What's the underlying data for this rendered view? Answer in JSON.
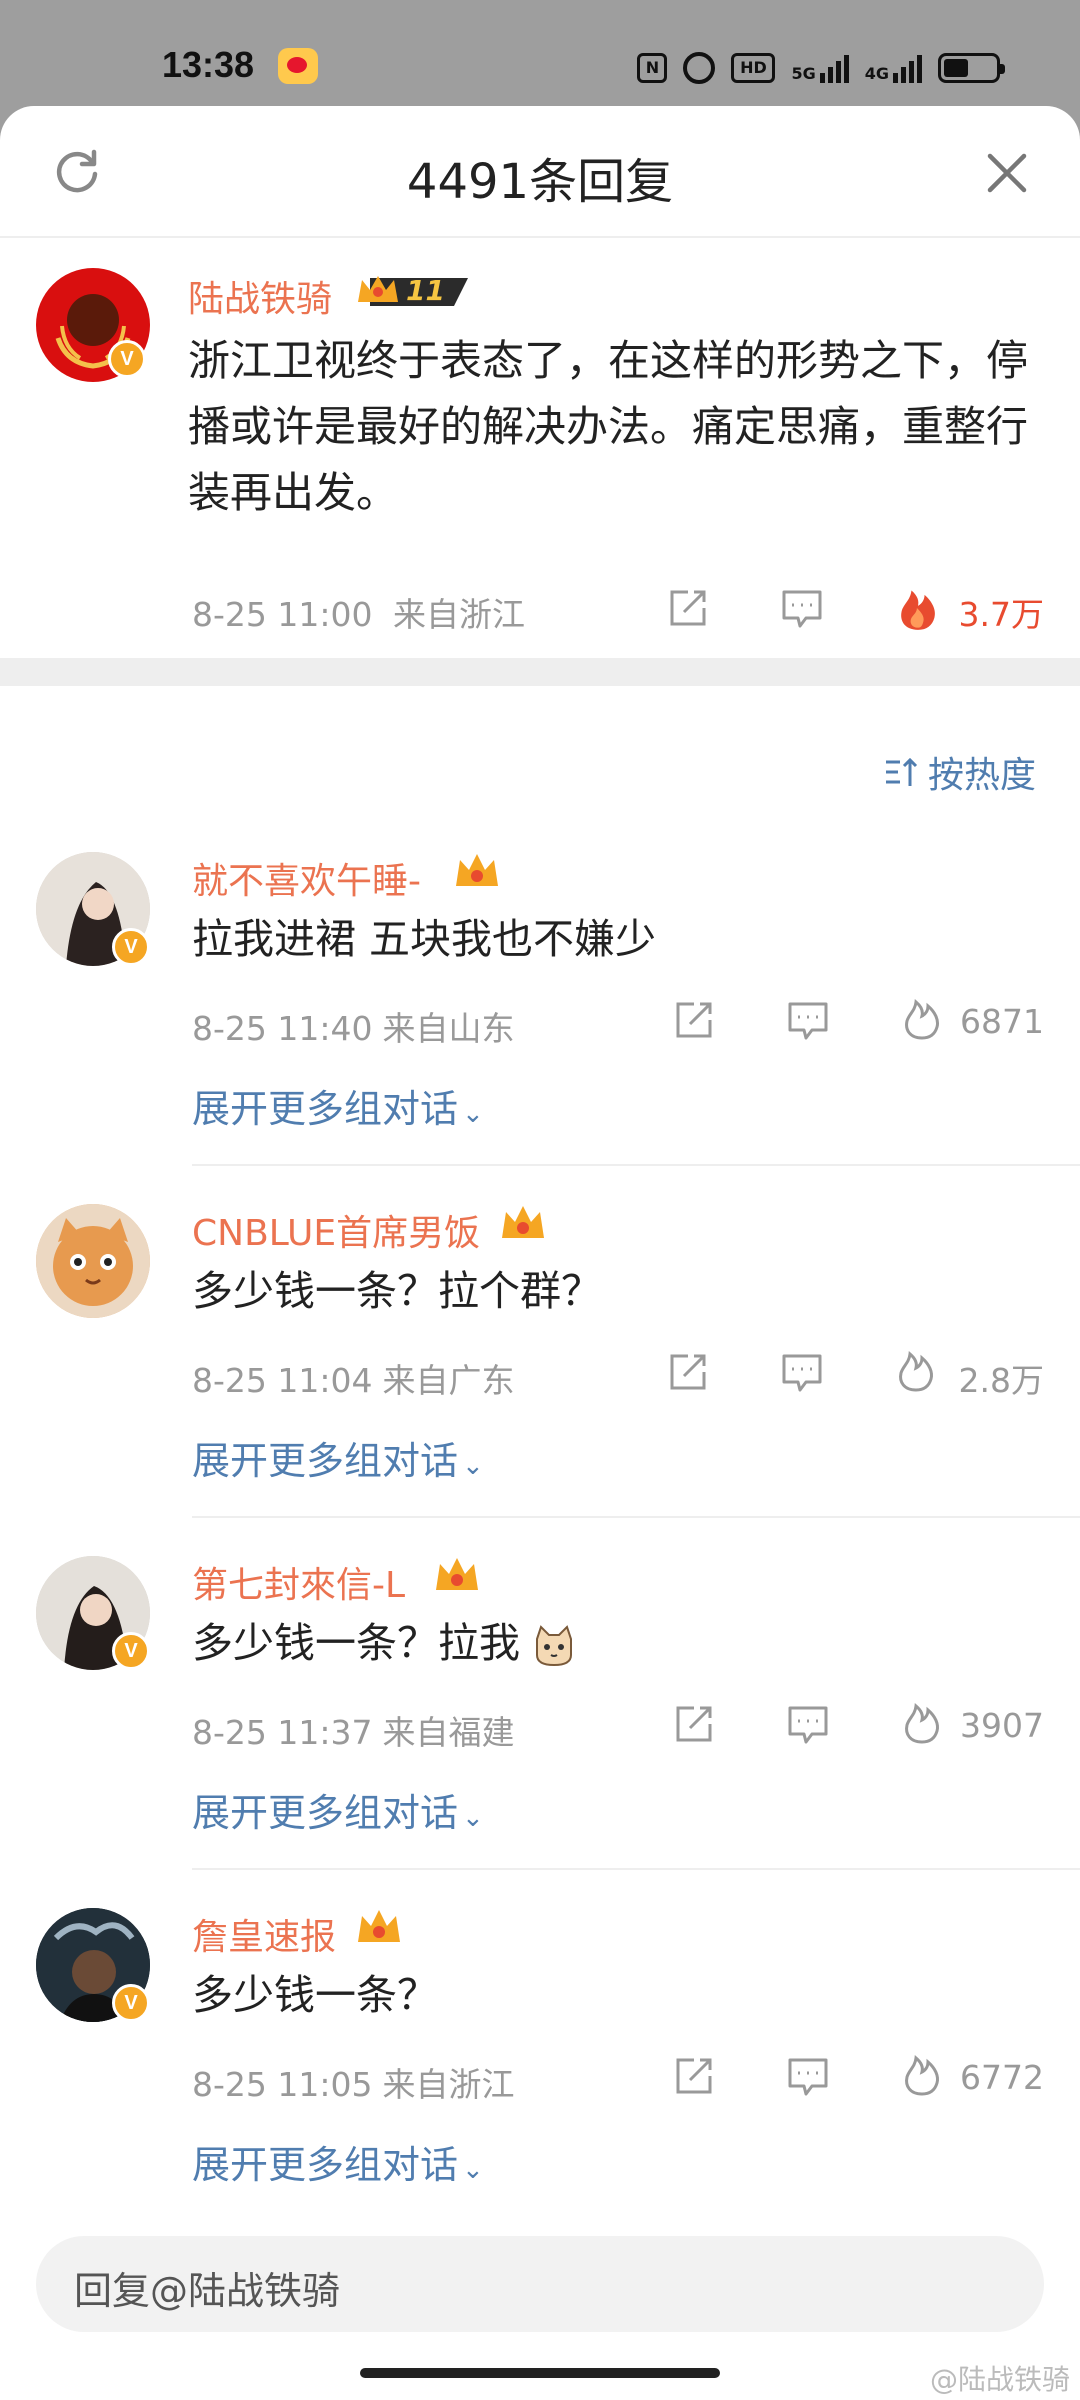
{
  "status_bar": {
    "time": "13:38",
    "network_1": "5G",
    "network_2": "4G",
    "hd_label": "HD"
  },
  "sheet": {
    "title": "4491条回复"
  },
  "main_comment": {
    "username": "陆战铁骑",
    "level": "11",
    "text": "浙江卫视终于表态了，在这样的形势之下，停播或许是最好的解决办法。痛定思痛，重整行装再出发。",
    "timestamp": "8-25 11:00",
    "location": "来自浙江",
    "likes": "3.7万"
  },
  "sort": {
    "label": "按热度"
  },
  "replies": [
    {
      "username": "就不喜欢午睡-",
      "text": "拉我进裙 五块我也不嫌少",
      "timestamp": "8-25 11:40",
      "location": "来自山东",
      "likes": "6871",
      "expand": "展开更多组对话"
    },
    {
      "username": "CNBLUE首席男饭",
      "text": "多少钱一条？拉个群？",
      "timestamp": "8-25 11:04",
      "location": "来自广东",
      "likes": "2.8万",
      "expand": "展开更多组对话"
    },
    {
      "username": "第七封來信-L",
      "text": "多少钱一条？拉我",
      "timestamp": "8-25 11:37",
      "location": "来自福建",
      "likes": "3907",
      "expand": "展开更多组对话"
    },
    {
      "username": "詹皇速报",
      "text": "多少钱一条？",
      "timestamp": "8-25 11:05",
      "location": "来自浙江",
      "likes": "6772",
      "expand": "展开更多组对话"
    }
  ],
  "reply_input": {
    "placeholder": "回复@陆战铁骑"
  },
  "watermark": "@陆战铁骑",
  "colors": {
    "username": "#eb7350",
    "link": "#507daf",
    "hot_like": "#e84b2f",
    "meta": "#999999"
  },
  "icons": [
    "refresh-icon",
    "close-icon",
    "share-icon",
    "comment-icon",
    "like-flame-icon",
    "sort-icon",
    "crown-icon",
    "verified-badge-icon"
  ]
}
